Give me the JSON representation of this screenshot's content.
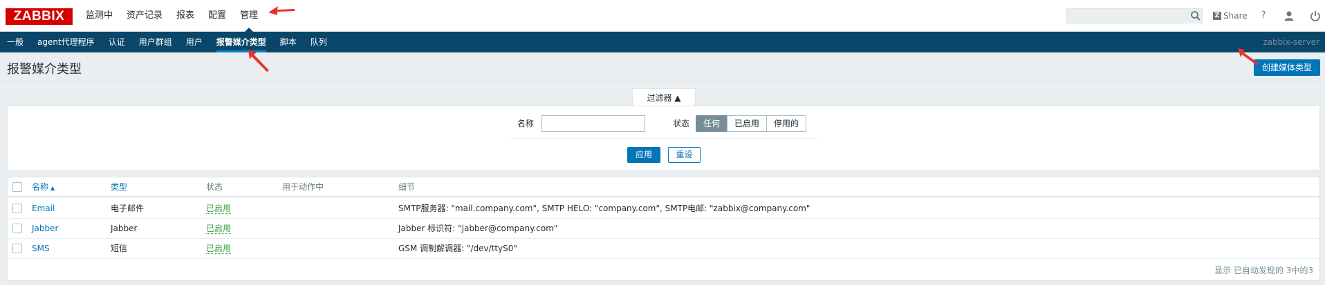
{
  "header": {
    "logo": "ZABBIX",
    "menu": [
      "监测中",
      "资产记录",
      "报表",
      "配置",
      "管理"
    ],
    "selected_menu_index": 4,
    "share_label": "Share",
    "help_label": "?"
  },
  "submenu": {
    "items": [
      "一般",
      "agent代理程序",
      "认证",
      "用户群组",
      "用户",
      "报警媒介类型",
      "脚本",
      "队列"
    ],
    "selected_index": 5,
    "server_name": "zabbix-server"
  },
  "page": {
    "title": "报警媒介类型",
    "create_button": "创建媒体类型"
  },
  "filter": {
    "tab_label": "过滤器 ▲",
    "name_label": "名称",
    "name_value": "",
    "status_label": "状态",
    "status_options": [
      "任何",
      "已启用",
      "停用的"
    ],
    "status_selected": "任何",
    "apply_label": "应用",
    "reset_label": "重设"
  },
  "table": {
    "headers": {
      "name": "名称",
      "type": "类型",
      "status": "状态",
      "used_in_actions": "用于动作中",
      "details": "细节"
    },
    "sort_indicator": "▲",
    "rows": [
      {
        "name": "Email",
        "type": "电子邮件",
        "status": "已启用",
        "used_in_actions": "",
        "details": "SMTP服务器: \"mail.company.com\", SMTP HELO: \"company.com\", SMTP电邮: \"zabbix@company.com\""
      },
      {
        "name": "Jabber",
        "type": "Jabber",
        "status": "已启用",
        "used_in_actions": "",
        "details": "Jabber 标识符: \"jabber@company.com\""
      },
      {
        "name": "SMS",
        "type": "短信",
        "status": "已启用",
        "used_in_actions": "",
        "details": "GSM 调制解调器: \"/dev/ttyS0\""
      }
    ],
    "footer": "显示 已自动发现的 3中的3"
  },
  "colors": {
    "brand_red": "#d40000",
    "nav_dark": "#0a466a",
    "accent_blue": "#0275b8",
    "enabled_green": "#429e47",
    "annotation_red": "#e8312f"
  }
}
